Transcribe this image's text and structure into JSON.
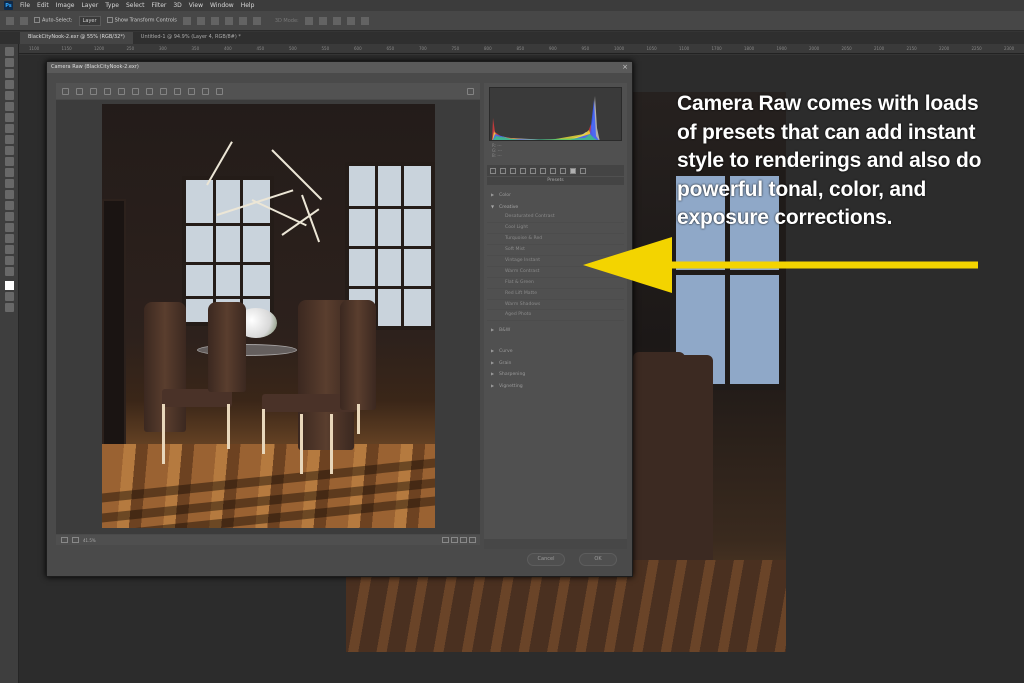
{
  "menubar": {
    "logo": "Ps",
    "items": [
      "File",
      "Edit",
      "Image",
      "Layer",
      "Type",
      "Select",
      "Filter",
      "3D",
      "View",
      "Window",
      "Help"
    ]
  },
  "options": {
    "auto_select": "Auto-Select:",
    "layer_select": "Layer",
    "transform": "Show Transform Controls",
    "mode_3d": "3D Mode:"
  },
  "tabs": [
    {
      "label": "BlackCityNook-2.exr @ 55% (RGB/32*)"
    },
    {
      "label": "Untitled-1 @ 94.9% (Layer 4, RGB/8#) *"
    }
  ],
  "ruler": [
    "1100",
    "1150",
    "1200",
    "250",
    "300",
    "350",
    "400",
    "450",
    "500",
    "550",
    "600",
    "650",
    "700",
    "750",
    "800",
    "850",
    "900",
    "950",
    "1000",
    "1050",
    "1100",
    "1700",
    "1800",
    "1900",
    "2000",
    "2050",
    "2100",
    "2150",
    "2200",
    "2250",
    "2300"
  ],
  "dialog": {
    "title": "Camera Raw (BlackCityNook-2.exr)",
    "zoom": "41.5%",
    "cancel": "Cancel",
    "ok": "OK"
  },
  "panel": {
    "rgb": [
      "R: ---",
      "G: ---",
      "B: ---"
    ],
    "presets_header": "Presets",
    "groups": [
      {
        "label": "Color",
        "open": false,
        "items": []
      },
      {
        "label": "Creative",
        "open": true,
        "items": [
          "Desaturated Contrast",
          "Cool Light",
          "Turquoise & Red",
          "Soft Mist",
          "Vintage Instant",
          "Warm Contrast",
          "Flat & Green",
          "Red Lift Matte",
          "Warm Shadows",
          "Aged Photo"
        ]
      },
      {
        "label": "B&W",
        "open": false,
        "items": []
      },
      {
        "label": "Curve",
        "open": false,
        "items": []
      },
      {
        "label": "Grain",
        "open": false,
        "items": []
      },
      {
        "label": "Sharpening",
        "open": false,
        "items": []
      },
      {
        "label": "Vignetting",
        "open": false,
        "items": []
      }
    ]
  },
  "annotation": {
    "text": "Camera Raw comes with loads\nof presets that can add instant\nstyle to renderings and also do\npowerful tonal, color, and\nexposure corrections."
  },
  "colors": {
    "arrow": "#f3d400",
    "annotation_text": "#ffffff",
    "photoshop_blue": "#31a8ff"
  }
}
